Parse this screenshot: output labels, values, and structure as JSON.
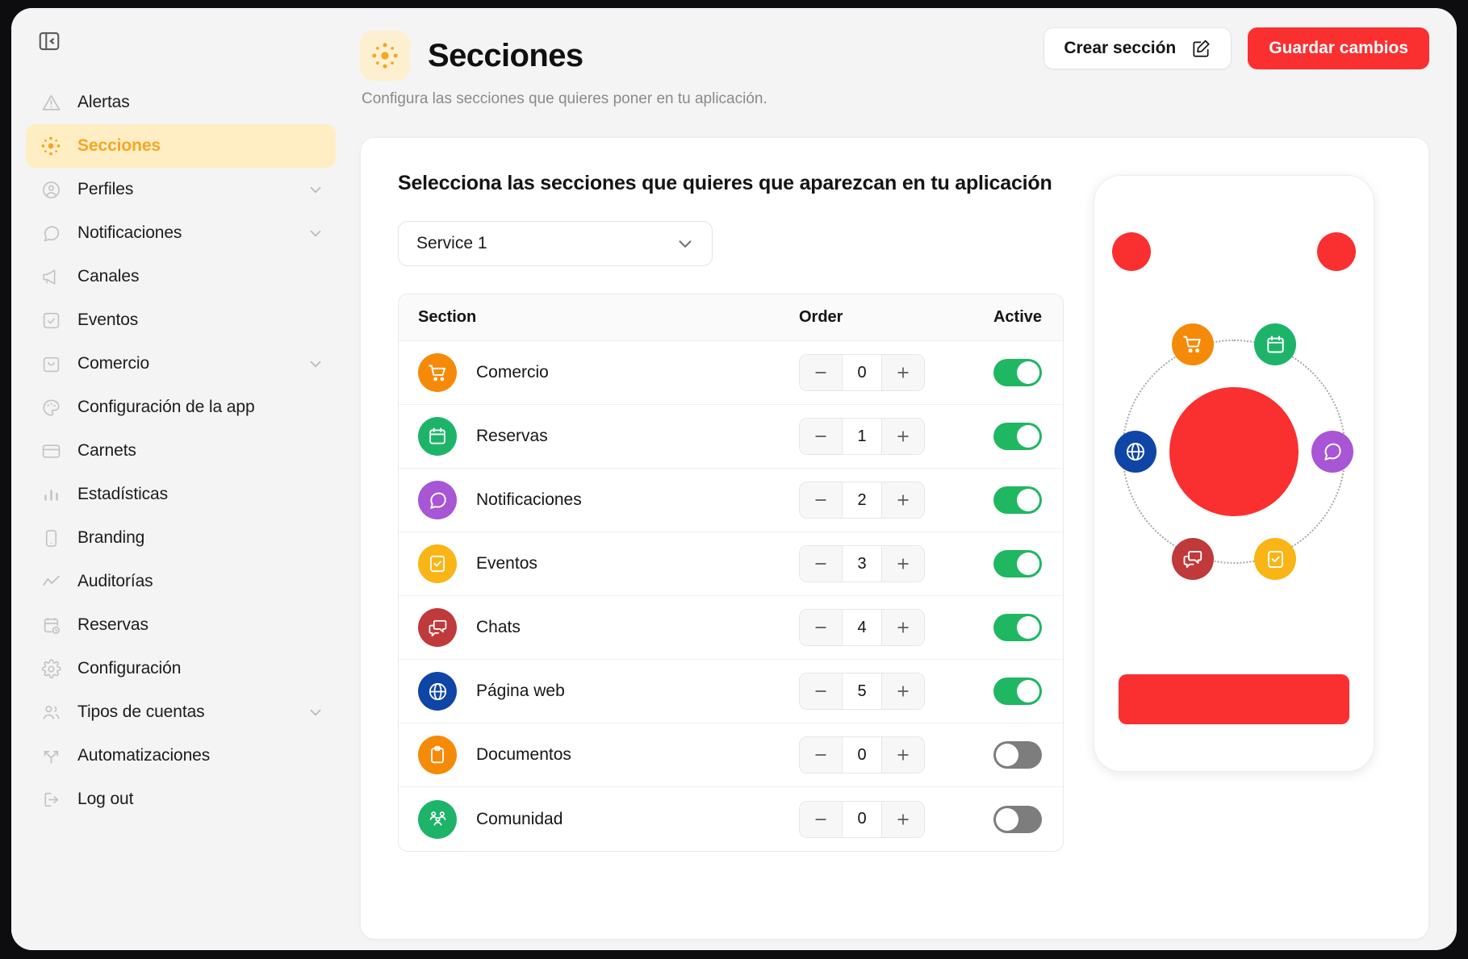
{
  "app": {
    "collapse_icon": "panel-collapse-icon"
  },
  "sidebar": {
    "items": [
      {
        "label": "Alertas",
        "icon": "alert-triangle-icon",
        "active": false,
        "expandable": false
      },
      {
        "label": "Secciones",
        "icon": "sections-icon",
        "active": true,
        "expandable": false
      },
      {
        "label": "Perfiles",
        "icon": "user-circle-icon",
        "active": false,
        "expandable": true
      },
      {
        "label": "Notificaciones",
        "icon": "chat-bubble-icon",
        "active": false,
        "expandable": true
      },
      {
        "label": "Canales",
        "icon": "megaphone-icon",
        "active": false,
        "expandable": false
      },
      {
        "label": "Eventos",
        "icon": "check-square-icon",
        "active": false,
        "expandable": false
      },
      {
        "label": "Comercio",
        "icon": "shopping-bag-icon",
        "active": false,
        "expandable": true
      },
      {
        "label": "Configuración de la app",
        "icon": "palette-icon",
        "active": false,
        "expandable": false
      },
      {
        "label": "Carnets",
        "icon": "card-icon",
        "active": false,
        "expandable": false
      },
      {
        "label": "Estadísticas",
        "icon": "bar-chart-icon",
        "active": false,
        "expandable": false
      },
      {
        "label": "Branding",
        "icon": "mobile-icon",
        "active": false,
        "expandable": false
      },
      {
        "label": "Auditorías",
        "icon": "activity-line-icon",
        "active": false,
        "expandable": false
      },
      {
        "label": "Reservas",
        "icon": "calendar-clock-icon",
        "active": false,
        "expandable": false
      },
      {
        "label": "Configuración",
        "icon": "gear-icon",
        "active": false,
        "expandable": false
      },
      {
        "label": "Tipos de cuentas",
        "icon": "users-icon",
        "active": false,
        "expandable": true
      },
      {
        "label": "Automatizaciones",
        "icon": "branch-icon",
        "active": false,
        "expandable": false
      },
      {
        "label": "Log out",
        "icon": "logout-icon",
        "active": false,
        "expandable": false
      }
    ]
  },
  "header": {
    "title": "Secciones",
    "subtitle": "Configura las secciones que quieres poner en tu aplicación.",
    "badge_icon": "sections-icon",
    "create_button": "Crear sección",
    "create_button_icon": "edit-square-icon",
    "save_button": "Guardar cambios"
  },
  "content": {
    "card_title": "Selecciona las secciones que quieres que aparezcan en tu aplicación",
    "service_select": {
      "value": "Service 1",
      "icon": "chevron-down-icon"
    },
    "table": {
      "columns": [
        "Section",
        "Order",
        "Active"
      ],
      "minus_icon": "minus-icon",
      "plus_icon": "plus-icon",
      "rows": [
        {
          "name": "Comercio",
          "icon": "cart-icon",
          "color": "#f58a09",
          "order": "0",
          "active": true
        },
        {
          "name": "Reservas",
          "icon": "calendar-icon",
          "color": "#1db46a",
          "order": "1",
          "active": true
        },
        {
          "name": "Notificaciones",
          "icon": "chat-icon",
          "color": "#a martinez",
          "order": "2",
          "active": true
        },
        {
          "name": "Eventos",
          "icon": "check-box-icon",
          "color": "#f9b516",
          "order": "3",
          "active": true
        },
        {
          "name": "Chats",
          "icon": "chats-icon",
          "color": "#c0393b",
          "order": "4",
          "active": true
        },
        {
          "name": "Página web",
          "icon": "globe-icon",
          "color": "#0f45a6",
          "order": "5",
          "active": true
        },
        {
          "name": "Documentos",
          "icon": "clipboard-icon",
          "color": "#f58a09",
          "order": "0",
          "active": false
        },
        {
          "name": "Comunidad",
          "icon": "community-icon",
          "color": "#1db46a",
          "order": "0",
          "active": false
        }
      ]
    }
  },
  "preview": {
    "brand_color": "#fa2f30",
    "orbit_icons": [
      {
        "icon": "cart-icon",
        "color": "#f58a09",
        "pos": "top-left"
      },
      {
        "icon": "calendar-icon",
        "color": "#1db46a",
        "pos": "top-right"
      },
      {
        "icon": "globe-icon",
        "color": "#0f45a6",
        "pos": "left"
      },
      {
        "icon": "chat-icon",
        "color": "#a855d6",
        "pos": "right"
      },
      {
        "icon": "chats-icon",
        "color": "#c0393b",
        "pos": "bottom-left"
      },
      {
        "icon": "check-box-icon",
        "color": "#f9b516",
        "pos": "bottom-right"
      }
    ]
  },
  "palette": {
    "orange": "#f58a09",
    "green": "#1db46a",
    "purple": "#a855d6",
    "yellow": "#f9b516",
    "dark_red": "#c0393b",
    "blue": "#0f45a6",
    "brand_red": "#fa2f30",
    "accent_amber": "#f5a623"
  }
}
